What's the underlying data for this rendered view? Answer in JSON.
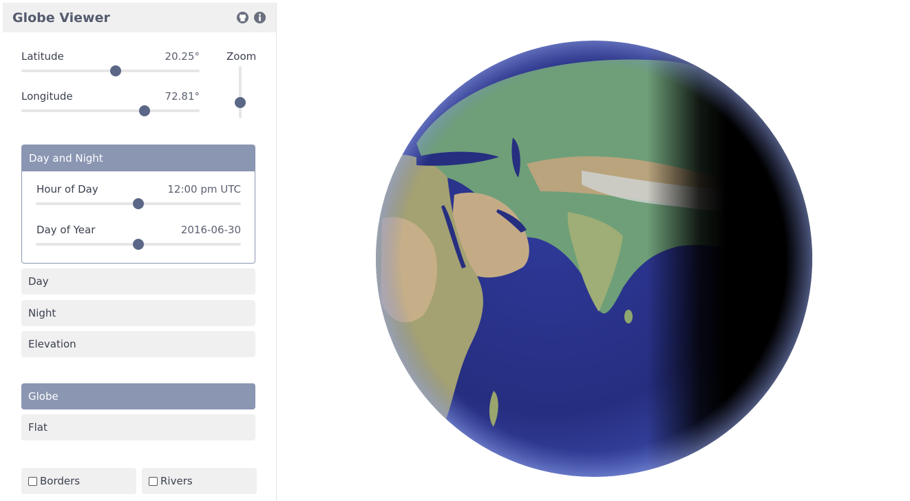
{
  "app": {
    "title": "Globe Viewer"
  },
  "header": {
    "icons": [
      "github-icon",
      "info-icon"
    ]
  },
  "position": {
    "latitude": {
      "label": "Latitude",
      "value": "20.25°",
      "fraction": 0.53
    },
    "longitude": {
      "label": "Longitude",
      "value": "72.81°",
      "fraction": 0.69
    },
    "zoom": {
      "label": "Zoom",
      "fraction": 0.7
    }
  },
  "day_night": {
    "title": "Day and Night",
    "hour": {
      "label": "Hour of Day",
      "value": "12:00 pm UTC",
      "fraction": 0.5
    },
    "day": {
      "label": "Day of Year",
      "value": "2016-06-30",
      "fraction": 0.5
    }
  },
  "layers": [
    {
      "label": "Day"
    },
    {
      "label": "Night"
    },
    {
      "label": "Elevation"
    }
  ],
  "projection": [
    {
      "label": "Globe",
      "selected": true
    },
    {
      "label": "Flat",
      "selected": false
    }
  ],
  "overlays": [
    {
      "label": "Borders",
      "checked": false
    },
    {
      "label": "Rivers",
      "checked": false
    }
  ],
  "colors": {
    "accent": "#8a96b2",
    "thumb": "#5a6786",
    "ocean": "#2a3287"
  }
}
